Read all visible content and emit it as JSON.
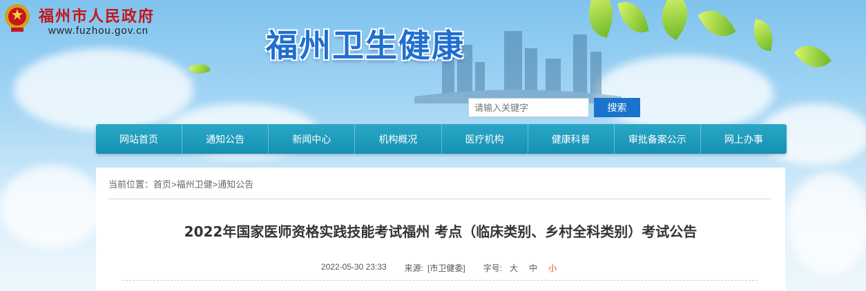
{
  "header": {
    "site_name": "福州市人民政府",
    "site_url": "www.fuzhou.gov.cn",
    "brand_title": "福州卫生健康"
  },
  "search": {
    "placeholder": "请输入关键字",
    "button_label": "搜索"
  },
  "nav": {
    "items": [
      "网站首页",
      "通知公告",
      "新闻中心",
      "机构概况",
      "医疗机构",
      "健康科普",
      "审批备案公示",
      "网上办事"
    ]
  },
  "breadcrumb": {
    "prefix": "当前位置：",
    "home": "首页",
    "sep1": ">",
    "section": "福州卫健",
    "sep2": ">",
    "current": "通知公告"
  },
  "article": {
    "title": "2022年国家医师资格实践技能考试福州 考点（临床类别、乡村全科类别）考试公告",
    "date": "2022-05-30 23:33",
    "source_label": "来源:",
    "source_value": "[市卫健委]",
    "font_label": "字号:",
    "font_large": "大",
    "font_medium": "中",
    "font_small": "小"
  },
  "colors": {
    "site_name": "#c4161c",
    "brand": "#1f6fd0",
    "nav": "#1a9abd",
    "search_button": "#1a73cd",
    "active_font": "#d9531e"
  }
}
